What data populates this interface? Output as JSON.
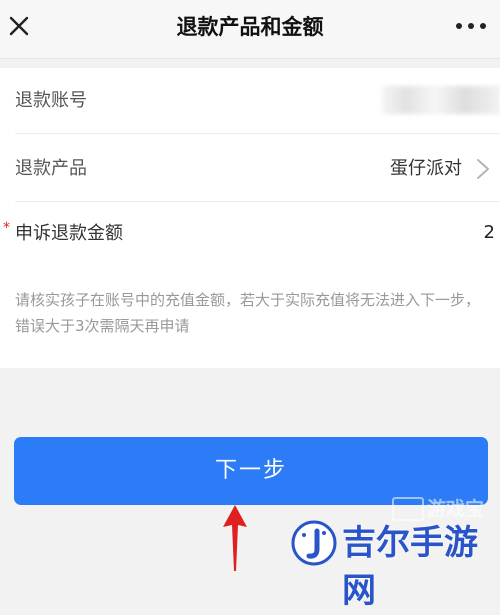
{
  "header": {
    "title": "退款产品和金额",
    "close_icon": "close-icon",
    "more_icon": "more-icon"
  },
  "form": {
    "account_label": "退款账号",
    "product_label": "退款产品",
    "product_value": "蛋仔派对",
    "amount_required_mark": "*",
    "amount_label": "申诉退款金额",
    "amount_value": "2",
    "hint": "请核实孩子在账号中的充值金额，若大于实际充值将无法进入下一步，错误大于3次需隔天再申请"
  },
  "actions": {
    "next_label": "下一步"
  },
  "watermark": {
    "top_text": "游戏宝",
    "brand_text": "吉尔手游网"
  },
  "colors": {
    "primary": "#2b7cf6",
    "required": "#e02020",
    "hint": "#999999",
    "arrow": "#e02020"
  }
}
